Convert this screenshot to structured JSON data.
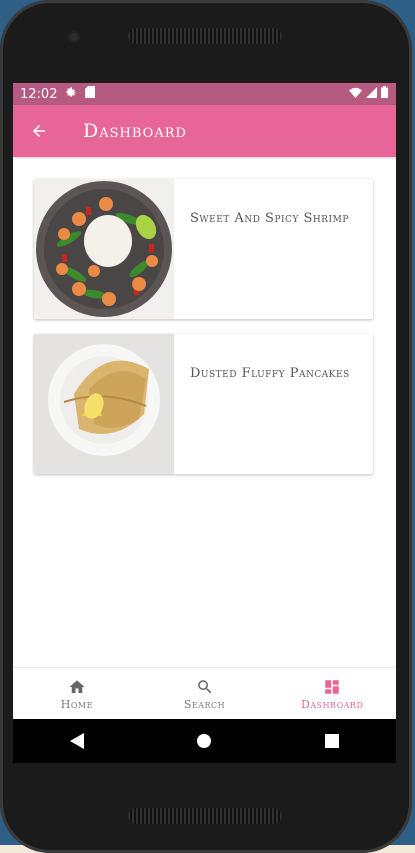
{
  "status_bar": {
    "time": "12:02"
  },
  "app_bar": {
    "title": "Dashboard"
  },
  "recipes": [
    {
      "title": "Sweet And Spicy Shrimp"
    },
    {
      "title": "Dusted Fluffy Pancakes"
    }
  ],
  "bottom_nav": {
    "items": [
      {
        "label": "Home",
        "icon": "home-icon"
      },
      {
        "label": "Search",
        "icon": "search-icon"
      },
      {
        "label": "Dashboard",
        "icon": "dashboard-icon",
        "active": true
      }
    ]
  },
  "colors": {
    "accent": "#e86598",
    "status": "#b65a82"
  }
}
